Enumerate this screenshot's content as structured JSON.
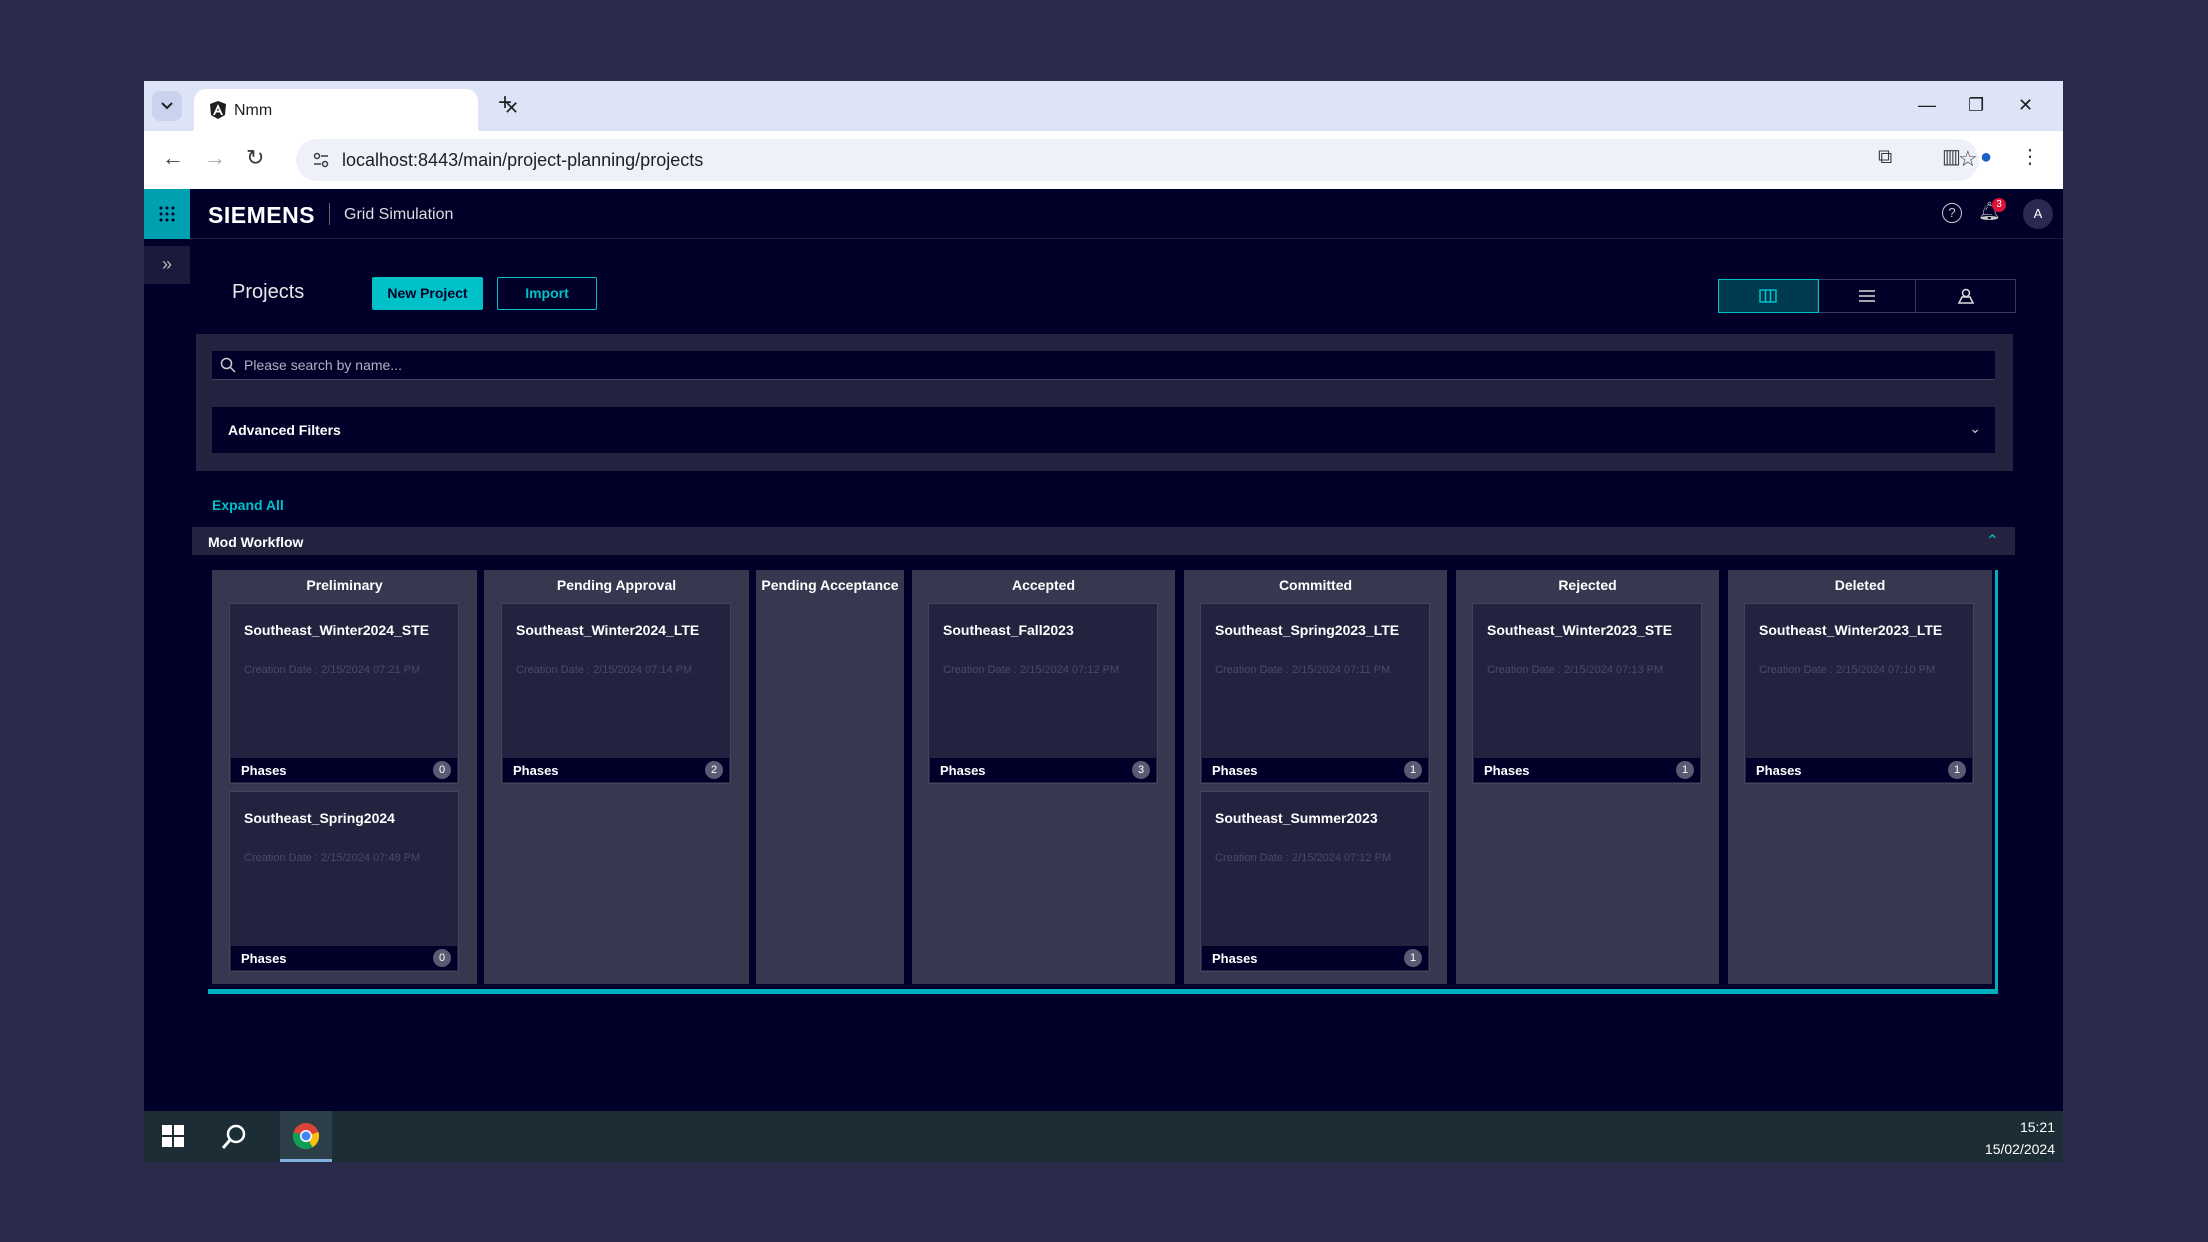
{
  "browser": {
    "tab_title": "Nmm",
    "url": "localhost:8443/main/project-planning/projects"
  },
  "app": {
    "brand": "SIEMENS",
    "name": "Grid Simulation",
    "notification_count": "3",
    "avatar_initial": "A"
  },
  "page": {
    "title": "Projects",
    "new_project_label": "New Project",
    "import_label": "Import",
    "search_placeholder": "Please search by name...",
    "advanced_filters_label": "Advanced Filters",
    "expand_all_label": "Expand All",
    "workflow_title": "Mod Workflow"
  },
  "board": {
    "phases_label": "Phases",
    "date_prefix": "Creation Date : ",
    "columns": [
      {
        "title": "Preliminary",
        "cards": [
          {
            "name": "Southeast_Winter2024_STE",
            "date": "2/15/2024 07:21 PM",
            "phases": "0"
          },
          {
            "name": "Southeast_Spring2024",
            "date": "2/15/2024 07:48 PM",
            "phases": "0"
          }
        ]
      },
      {
        "title": "Pending Approval",
        "cards": [
          {
            "name": "Southeast_Winter2024_LTE",
            "date": "2/15/2024 07:14 PM",
            "phases": "2"
          }
        ]
      },
      {
        "title": "Pending Acceptance",
        "cards": []
      },
      {
        "title": "Accepted",
        "cards": [
          {
            "name": "Southeast_Fall2023",
            "date": "2/15/2024 07:12 PM",
            "phases": "3"
          }
        ]
      },
      {
        "title": "Committed",
        "cards": [
          {
            "name": "Southeast_Spring2023_LTE",
            "date": "2/15/2024 07:11 PM",
            "phases": "1"
          },
          {
            "name": "Southeast_Summer2023",
            "date": "2/15/2024 07:12 PM",
            "phases": "1"
          }
        ]
      },
      {
        "title": "Rejected",
        "cards": [
          {
            "name": "Southeast_Winter2023_STE",
            "date": "2/15/2024 07:13 PM",
            "phases": "1"
          }
        ]
      },
      {
        "title": "Deleted",
        "cards": [
          {
            "name": "Southeast_Winter2023_LTE",
            "date": "2/15/2024 07:10 PM",
            "phases": "1"
          }
        ]
      }
    ]
  },
  "taskbar": {
    "time": "15:21",
    "date": "15/02/2024"
  },
  "colors": {
    "accent": "#00c0c8",
    "background": "#000028",
    "panel": "#23233f",
    "column": "#37374f"
  }
}
